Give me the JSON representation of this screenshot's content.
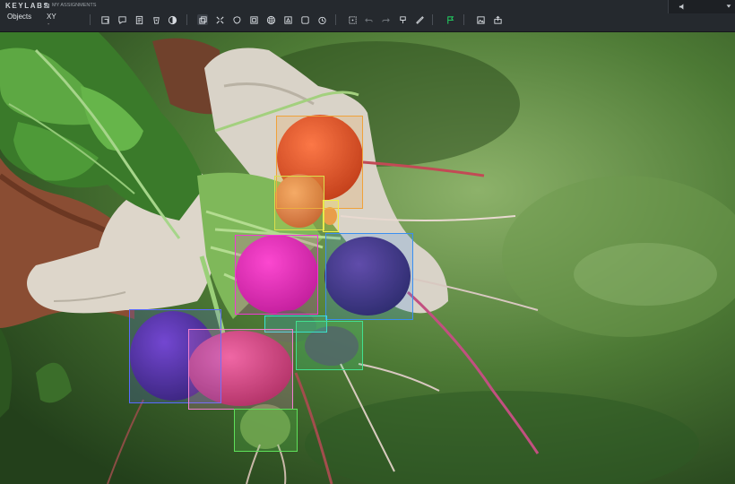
{
  "app": {
    "logo": "KEYLABS",
    "assignments_label": "MY ASSIGNMENTS"
  },
  "tabs": {
    "objects": "Objects",
    "xy": "XY",
    "xy_sub": "-"
  },
  "toolbar_icons": [
    "crop-icon",
    "comment-icon",
    "document-icon",
    "bucket-icon",
    "contrast-icon",
    "copy-icon",
    "expand-icon",
    "blob-icon",
    "layers-icon",
    "grid-icon",
    "polygon-icon",
    "panel-icon",
    "timer-icon",
    "select-icon",
    "undo-icon",
    "redo-icon",
    "paint-icon",
    "ruler-icon",
    "flag-icon",
    "image-icon",
    "share-icon"
  ],
  "colors": {
    "topbar": "#25292e",
    "flag_active": "#22c55e"
  },
  "annotations": [
    {
      "label": "red-orange radish",
      "color": "#f0a23a"
    },
    {
      "label": "small orange radish",
      "color": "#dadf4d"
    },
    {
      "label": "tiny yellow radish",
      "color": "#eef04a"
    },
    {
      "label": "magenta radish",
      "color": "#f03ad4"
    },
    {
      "label": "purple radish",
      "color": "#3a8ff0"
    },
    {
      "label": "cyan hidden radish",
      "color": "#3ae0d7"
    },
    {
      "label": "green hidden radish",
      "color": "#43e08f"
    },
    {
      "label": "violet radish left",
      "color": "#5a6bff"
    },
    {
      "label": "pink radish",
      "color": "#f27fd0"
    },
    {
      "label": "green radish bottom",
      "color": "#5ee05a"
    }
  ]
}
